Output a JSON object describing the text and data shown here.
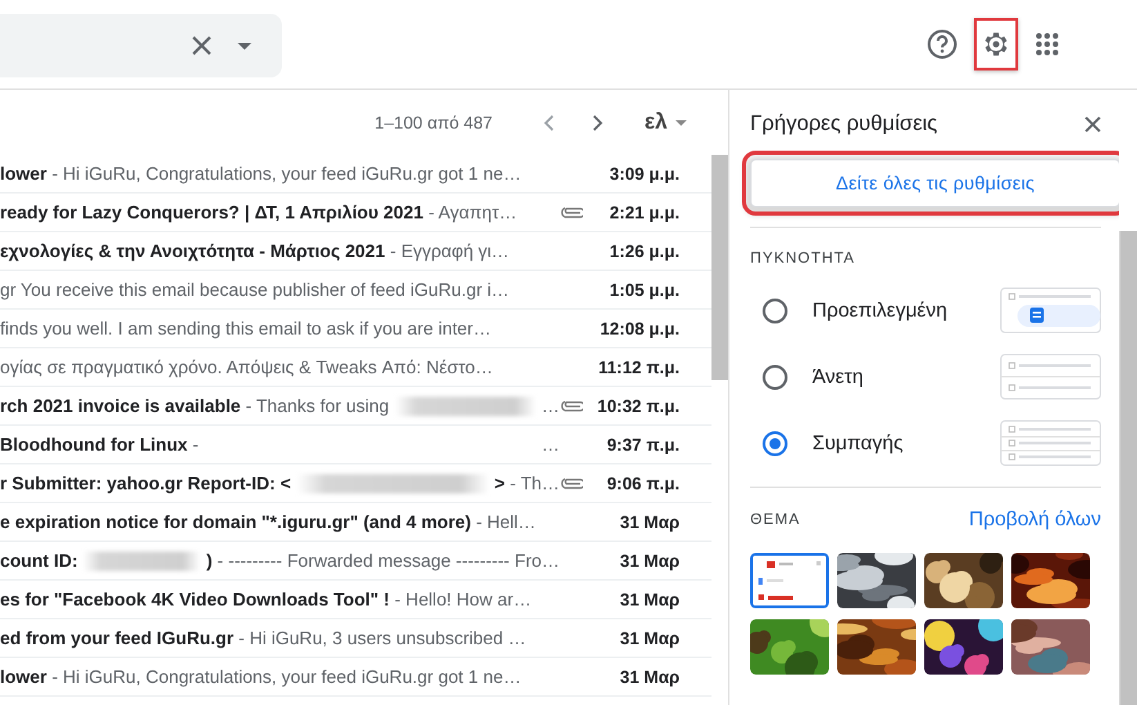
{
  "header": {
    "settings_highlighted": true
  },
  "toolbar": {
    "range": "1–100 από 487",
    "input_tool": "ελ"
  },
  "messages": [
    {
      "parts": [
        {
          "kind": "text",
          "text": "**lower** - Hi iGuRu, Congratulations, your feed iGuRu.gr got 1 ne…"
        }
      ],
      "attachment": false,
      "time": "3:09 μ.μ."
    },
    {
      "parts": [
        {
          "kind": "text",
          "text": "**ready for Lazy Conquerors? | ΔΤ, 1 Απριλίου 2021** - Αγαπητ…"
        }
      ],
      "attachment": true,
      "time": "2:21 μ.μ."
    },
    {
      "parts": [
        {
          "kind": "text",
          "text": "**εχνολογίες & την Ανοιχτότητα - Μάρτιος 2021** - Εγγραφή γι…"
        }
      ],
      "attachment": false,
      "time": "1:26 μ.μ."
    },
    {
      "parts": [
        {
          "kind": "text",
          "text": "gr You receive this email because publisher of feed iGuRu.gr i…"
        }
      ],
      "attachment": false,
      "time": "1:05 μ.μ."
    },
    {
      "parts": [
        {
          "kind": "text",
          "text": "finds you well. I am sending this email to ask if you are inter…"
        }
      ],
      "attachment": false,
      "time": "12:08 μ.μ."
    },
    {
      "parts": [
        {
          "kind": "text",
          "text": "ογίας σε πραγματικό χρόνο. Απόψεις & Tweaks Από: Νέστο…"
        }
      ],
      "attachment": false,
      "time": "11:12 π.μ."
    },
    {
      "parts": [
        {
          "kind": "text",
          "text": "**rch 2021 invoice is available** - Thanks for using"
        },
        {
          "kind": "blur"
        },
        {
          "kind": "text",
          "text": "…"
        }
      ],
      "attachment": true,
      "time": "10:32 π.μ."
    },
    {
      "parts": [
        {
          "kind": "text",
          "text": "**Bloodhound for Linux** -"
        },
        {
          "kind": "trailing",
          "text": "…"
        }
      ],
      "attachment": false,
      "time": "9:37 π.μ."
    },
    {
      "parts": [
        {
          "kind": "text",
          "text": "**r Submitter: yahoo.gr Report-ID: <**"
        },
        {
          "kind": "blur"
        },
        {
          "kind": "text",
          "text": "**>** - Th…"
        }
      ],
      "attachment": true,
      "time": "9:06 π.μ."
    },
    {
      "parts": [
        {
          "kind": "text",
          "text": "**e expiration notice for domain \"*.iguru.gr\" (and 4 more)** - Hell…"
        }
      ],
      "attachment": false,
      "time": "31 Μαρ"
    },
    {
      "parts": [
        {
          "kind": "text",
          "text": "**count ID:**"
        },
        {
          "kind": "blur"
        },
        {
          "kind": "text",
          "text": "**)** - --------- Forwarded message --------- Fro…"
        }
      ],
      "attachment": false,
      "time": "31 Μαρ"
    },
    {
      "parts": [
        {
          "kind": "text",
          "text": "**es for \"Facebook 4K Video Downloads Tool\" !** - Hello! How ar…"
        }
      ],
      "attachment": false,
      "time": "31 Μαρ"
    },
    {
      "parts": [
        {
          "kind": "text",
          "text": "**ed from your feed IGuRu.gr** - Hi iGuRu, 3 users unsubscribed …"
        }
      ],
      "attachment": false,
      "time": "31 Μαρ"
    },
    {
      "parts": [
        {
          "kind": "text",
          "text": "**lower** - Hi iGuRu, Congratulations, your feed iGuRu.gr got 1 ne…"
        }
      ],
      "attachment": false,
      "time": "31 Μαρ"
    }
  ],
  "quick_settings": {
    "title": "Γρήγορες ρυθμίσεις",
    "all_settings_button": {
      "label": "Δείτε όλες τις ρυθμίσεις",
      "highlighted": true
    },
    "density": {
      "heading": "ΠΥΚΝΟΤΗΤΑ",
      "options": [
        {
          "kind": "default",
          "label": "Προεπιλεγμένη",
          "selected": false
        },
        {
          "kind": "comfortable",
          "label": "Άνετη",
          "selected": false
        },
        {
          "kind": "compact",
          "label": "Συμπαγής",
          "selected": true
        }
      ]
    },
    "theme": {
      "heading": "ΘΕΜΑ",
      "view_all": "Προβολή όλων",
      "themes": [
        {
          "kind": "default",
          "selected": true
        },
        {
          "kind": "picture",
          "selected": false
        },
        {
          "kind": "picture",
          "selected": false
        },
        {
          "kind": "picture",
          "selected": false
        },
        {
          "kind": "picture",
          "selected": false
        },
        {
          "kind": "picture",
          "selected": false
        },
        {
          "kind": "picture",
          "selected": false
        },
        {
          "kind": "picture",
          "selected": false
        }
      ]
    }
  }
}
